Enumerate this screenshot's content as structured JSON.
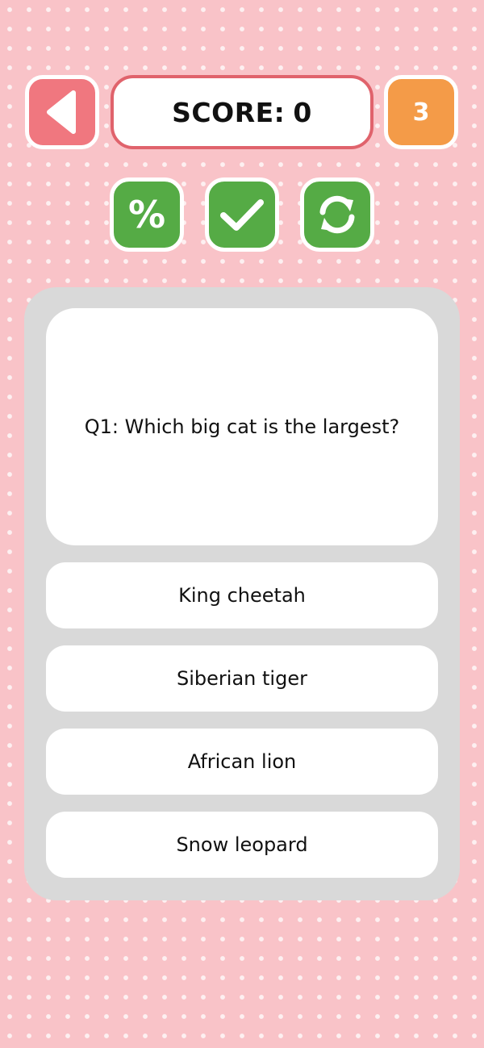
{
  "header": {
    "score_label": "SCORE:",
    "score_value": "0",
    "lives": "3"
  },
  "powerups": {
    "fifty_fifty_icon": "percent-icon",
    "check_icon": "checkmark-icon",
    "refresh_icon": "refresh-icon"
  },
  "quiz": {
    "question": "Q1: Which big cat is the largest?",
    "answers": [
      "King cheetah",
      "Siberian tiger",
      "African lion",
      "Snow leopard"
    ]
  },
  "colors": {
    "background": "#f9c3c8",
    "back_button": "#f0777f",
    "score_border": "#e0636c",
    "lives_badge": "#f49b48",
    "powerup_green": "#55ab45",
    "panel": "#d9d9d9"
  }
}
